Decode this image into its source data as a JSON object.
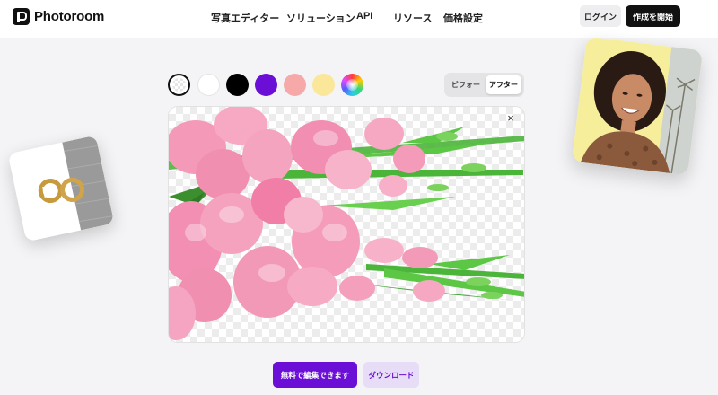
{
  "header": {
    "brand": "Photoroom",
    "nav": [
      "写真エディター",
      "ソリューション",
      "API",
      "リソース",
      "価格設定"
    ],
    "login_label": "ログイン",
    "start_label": "作成を開始"
  },
  "editor": {
    "color_swatches": [
      {
        "name": "transparent",
        "color": "transparent",
        "selected": true
      },
      {
        "name": "white",
        "color": "#ffffff"
      },
      {
        "name": "black",
        "color": "#000000"
      },
      {
        "name": "purple",
        "color": "#6b0fd6"
      },
      {
        "name": "pink",
        "color": "#f7a8a8"
      },
      {
        "name": "yellow",
        "color": "#fbe79a"
      },
      {
        "name": "custom",
        "color": "rainbow"
      }
    ],
    "toggle": {
      "before_label": "ビフォー",
      "after_label": "アフター",
      "active": "after"
    },
    "close_icon": "×"
  },
  "actions": {
    "edit_label": "無料で編集できます",
    "download_label": "ダウンロード"
  },
  "colors": {
    "accent": "#6b0fd6",
    "accent_light": "#e7ddf7",
    "dark": "#111111"
  }
}
